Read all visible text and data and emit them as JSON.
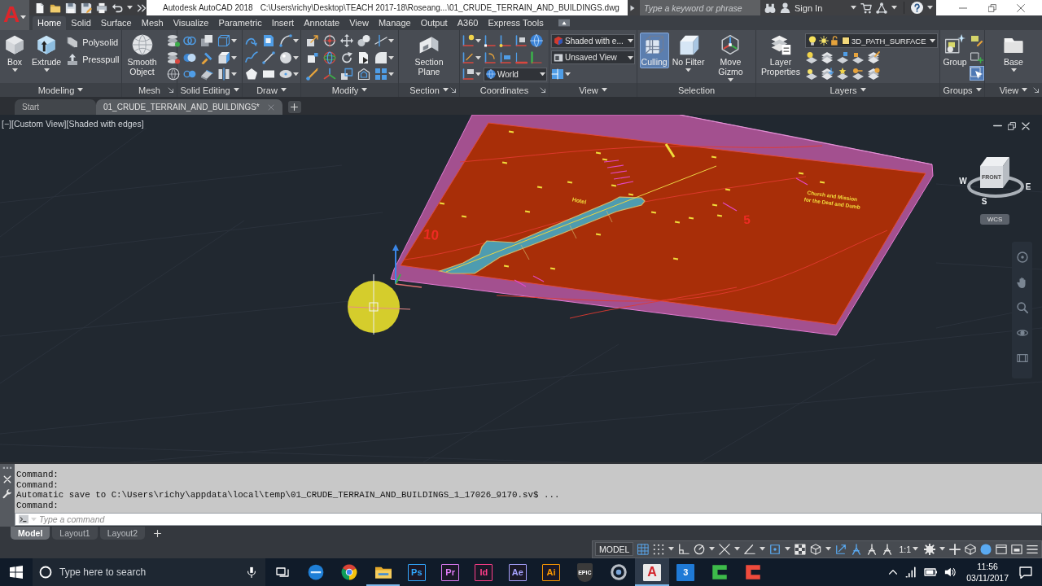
{
  "title_bar": {
    "app_button": "A",
    "title": "Autodesk AutoCAD 2018",
    "file_path": "C:\\Users\\richy\\Desktop\\TEACH 2017-18\\Roseang...\\01_CRUDE_TERRAIN_AND_BUILDINGS.dwg",
    "search": {
      "placeholder": "Type a keyword or phrase"
    },
    "sign_in": "Sign In"
  },
  "ribbon": {
    "tabs": [
      {
        "label": "Home",
        "selected": true
      },
      {
        "label": "Solid",
        "selected": false
      },
      {
        "label": "Surface",
        "selected": false
      },
      {
        "label": "Mesh",
        "selected": false
      },
      {
        "label": "Visualize",
        "selected": false
      },
      {
        "label": "Parametric",
        "selected": false
      },
      {
        "label": "Insert",
        "selected": false
      },
      {
        "label": "Annotate",
        "selected": false
      },
      {
        "label": "View",
        "selected": false
      },
      {
        "label": "Manage",
        "selected": false
      },
      {
        "label": "Output",
        "selected": false
      },
      {
        "label": "A360",
        "selected": false
      },
      {
        "label": "Express Tools",
        "selected": false
      }
    ],
    "panels": [
      {
        "title": "Modeling",
        "menu": true,
        "launcher": false,
        "tools": [
          {
            "kind": "large",
            "label": "Box",
            "dropdown": true,
            "on": false
          },
          {
            "kind": "large",
            "label": "Extrude",
            "dropdown": true,
            "on": false
          },
          {
            "kind": "small_list",
            "items": [
              "Polysolid",
              "Presspull"
            ]
          }
        ]
      },
      {
        "title": "Mesh",
        "menu": false,
        "launcher": true,
        "tools": [
          {
            "kind": "large",
            "label": "Smooth Object",
            "dropdown": false,
            "on": false
          },
          {
            "kind": "icon_grid"
          }
        ]
      },
      {
        "title": "Solid Editing",
        "menu": true,
        "launcher": false,
        "tools": [
          {
            "kind": "icon_grid"
          }
        ]
      },
      {
        "title": "Draw",
        "menu": true,
        "launcher": false,
        "tools": [
          {
            "kind": "icon_grid"
          }
        ]
      },
      {
        "title": "Modify",
        "menu": true,
        "launcher": false,
        "tools": [
          {
            "kind": "icon_grid"
          }
        ]
      },
      {
        "title": "Section",
        "menu": true,
        "launcher": true,
        "tools": [
          {
            "kind": "large",
            "label": "Section Plane",
            "dropdown": false,
            "on": false
          }
        ]
      },
      {
        "title": "Coordinates",
        "menu": false,
        "launcher": true,
        "tools": [
          {
            "kind": "icon_grid"
          },
          {
            "kind": "select",
            "value": "World"
          }
        ]
      },
      {
        "title": "View",
        "menu": true,
        "launcher": false,
        "tools": [
          {
            "kind": "select",
            "value": "Shaded with e..."
          },
          {
            "kind": "select",
            "value": "Unsaved View"
          },
          {
            "kind": "icon_grid"
          }
        ]
      },
      {
        "title": "Selection",
        "menu": false,
        "launcher": false,
        "tools": [
          {
            "kind": "large",
            "label": "Culling",
            "dropdown": false,
            "on": true
          },
          {
            "kind": "large",
            "label": "No Filter",
            "dropdown": true,
            "on": false
          },
          {
            "kind": "large",
            "label": "Move Gizmo",
            "dropdown": true,
            "on": false
          }
        ]
      },
      {
        "title": "Layers",
        "menu": true,
        "launcher": false,
        "tools": [
          {
            "kind": "large",
            "label": "Layer Properties",
            "dropdown": false,
            "on": false
          },
          {
            "kind": "layer_select",
            "value": "3D_PATH_SURFACE",
            "color": "#f3d87a"
          },
          {
            "kind": "icon_grid"
          }
        ]
      },
      {
        "title": "Groups",
        "menu": true,
        "launcher": false,
        "tools": [
          {
            "kind": "large",
            "label": "Group",
            "dropdown": false,
            "on": false
          },
          {
            "kind": "toggle_column",
            "items": [
              {
                "on": false
              },
              {
                "on": false
              },
              {
                "on": true
              }
            ]
          }
        ]
      },
      {
        "title": "View",
        "menu": true,
        "launcher": true,
        "tools": [
          {
            "kind": "large",
            "label": "Base",
            "dropdown": true,
            "on": false
          }
        ]
      }
    ]
  },
  "file_tabs": [
    {
      "label": "Start",
      "selected": false,
      "closable": false
    },
    {
      "label": "01_CRUDE_TERRAIN_AND_BUILDINGS*",
      "selected": true,
      "closable": true
    }
  ],
  "viewport": {
    "controls": [
      "[−]",
      "[Custom View]",
      "[Shaded with edges]"
    ],
    "drawing_labels": [
      {
        "kind": "contour",
        "text": "10"
      },
      {
        "kind": "contour",
        "text": "5"
      },
      {
        "kind": "note",
        "text": "Hotel"
      },
      {
        "kind": "note",
        "text": "Church and Mission"
      },
      {
        "kind": "note",
        "text": "for the Deaf and Dumb"
      }
    ],
    "view_cube": {
      "face": "FRONT",
      "compass": [
        "W",
        "S",
        "E"
      ],
      "ucs_button": "WCS"
    }
  },
  "command": {
    "history": [
      "Command:",
      "Command:",
      "Automatic save to C:\\Users\\richy\\appdata\\local\\temp\\01_CRUDE_TERRAIN_AND_BUILDINGS_1_17026_9170.sv$ ...",
      "Command:"
    ],
    "input": {
      "placeholder": "Type a command"
    }
  },
  "layout_tabs": [
    {
      "label": "Model",
      "selected": true
    },
    {
      "label": "Layout1",
      "selected": false
    },
    {
      "label": "Layout2",
      "selected": false
    }
  ],
  "status_bar": {
    "space": "MODEL",
    "toggles": [
      {
        "on": true
      },
      {
        "on": false
      },
      {
        "on": false
      },
      {
        "on": false
      },
      {
        "on": false
      },
      {
        "on": false
      },
      {
        "on": true
      },
      {
        "on": false
      },
      {
        "on": false
      },
      {
        "on": true
      },
      {
        "on": true
      },
      {
        "on": false
      },
      {
        "on": false
      },
      {
        "on": false
      },
      {
        "on": false
      },
      {
        "on": false
      },
      {
        "on": true
      },
      {
        "on": false
      },
      {
        "on": false
      },
      {
        "on": false
      }
    ],
    "scale": "1:1"
  },
  "taskbar": {
    "search": {
      "placeholder": "Type here to search"
    },
    "apps": [
      {
        "kind": "e_logo",
        "running": false,
        "selected": false
      },
      {
        "kind": "round_logo",
        "running": false,
        "selected": false
      },
      {
        "kind": "folder",
        "running": true,
        "selected": false
      },
      {
        "kind": "tile",
        "label": "Ps",
        "color": "#31a8ff",
        "running": false,
        "selected": false
      },
      {
        "kind": "tile",
        "label": "Pr",
        "color": "#e07cf7",
        "running": false,
        "selected": false
      },
      {
        "kind": "tile",
        "label": "Id",
        "color": "#ff3e8a",
        "running": false,
        "selected": false
      },
      {
        "kind": "tile",
        "label": "Ae",
        "color": "#a7a2ff",
        "running": false,
        "selected": false
      },
      {
        "kind": "tile",
        "label": "Ai",
        "color": "#ff9a00",
        "running": false,
        "selected": false
      },
      {
        "kind": "shield",
        "label": "EPIC",
        "running": false,
        "selected": false
      },
      {
        "kind": "ring_logo",
        "running": false,
        "selected": false
      },
      {
        "kind": "light_tile",
        "label": "A",
        "color": "#d2232a",
        "running": true,
        "selected": true
      },
      {
        "kind": "filled_tile",
        "label": "3",
        "color": "#1f7ad6",
        "running": false,
        "selected": false
      },
      {
        "kind": "bracket",
        "color": "#3dbb4a",
        "running": false,
        "selected": false
      },
      {
        "kind": "bracket",
        "color": "#ef4b3c",
        "running": false,
        "selected": false
      }
    ],
    "clock": {
      "time": "11:56",
      "date": "03/11/2017"
    }
  }
}
